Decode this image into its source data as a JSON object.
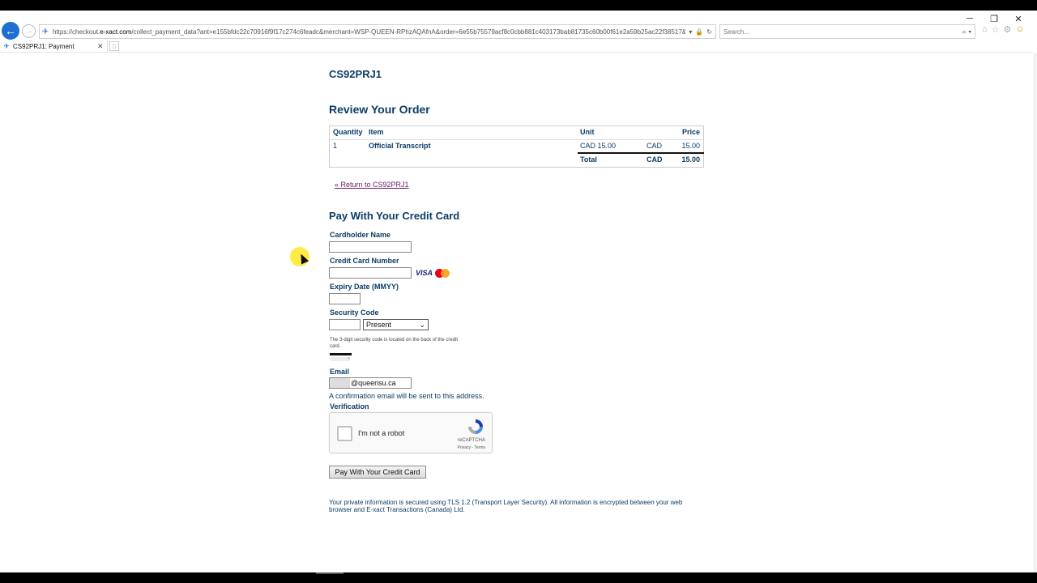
{
  "browser": {
    "url_prefix": "https://checkout.",
    "url_domain": "e-xact.com",
    "url_rest": "/collect_payment_data?ant=e155bfdc22c70916f9f17c274c6feadc&merchant=WSP-QUEEN-RPhzAQAfnA&order=6e55b75579acf8c0cbb881c403173bab81735c60b00f61e2a59b25ac22f38517&purch",
    "search_placeholder": "Search...",
    "tab_title": "CS92PRJ1: Payment",
    "win_minimize": "─",
    "win_restore": "❐",
    "win_close": "✕"
  },
  "page": {
    "store_id": "CS92PRJ1",
    "review_heading": "Review Your Order",
    "table": {
      "headers": {
        "quantity": "Quantity",
        "item": "Item",
        "unit": "Unit",
        "price": "Price"
      },
      "row": {
        "quantity": "1",
        "item": "Official Transcript",
        "unit": "CAD 15.00",
        "currency": "CAD",
        "price": "15.00"
      },
      "total": {
        "label": "Total",
        "currency": "CAD",
        "price": "15.00"
      }
    },
    "return_link": "« Return to CS92PRJ1",
    "pay_heading": "Pay With Your Credit Card",
    "fields": {
      "cardholder_label": "Cardholder Name",
      "card_number_label": "Credit Card Number",
      "expiry_label": "Expiry Date (MMYY)",
      "security_label": "Security Code",
      "security_select": "Present",
      "security_hint": "The 3-digit security code is located on the back of the credit card.",
      "email_label": "Email",
      "email_value": "@queensu.ca",
      "email_note": "A confirmation email will be sent to this address.",
      "verification_label": "Verification"
    },
    "card_brands": {
      "visa": "VISA"
    },
    "recaptcha": {
      "label": "I'm not a robot",
      "brand": "reCAPTCHA",
      "links": "Privacy - Terms"
    },
    "pay_button": "Pay With Your Credit Card",
    "security_note": "Your private information is secured using TLS 1.2 (Transport Layer Security). All information is encrypted between your web browser and E-xact Transactions (Canada) Ltd."
  },
  "colors": {
    "heading": "#0b3c66",
    "link": "#6b1a6b",
    "browser_accent": "#1e6fd1"
  }
}
